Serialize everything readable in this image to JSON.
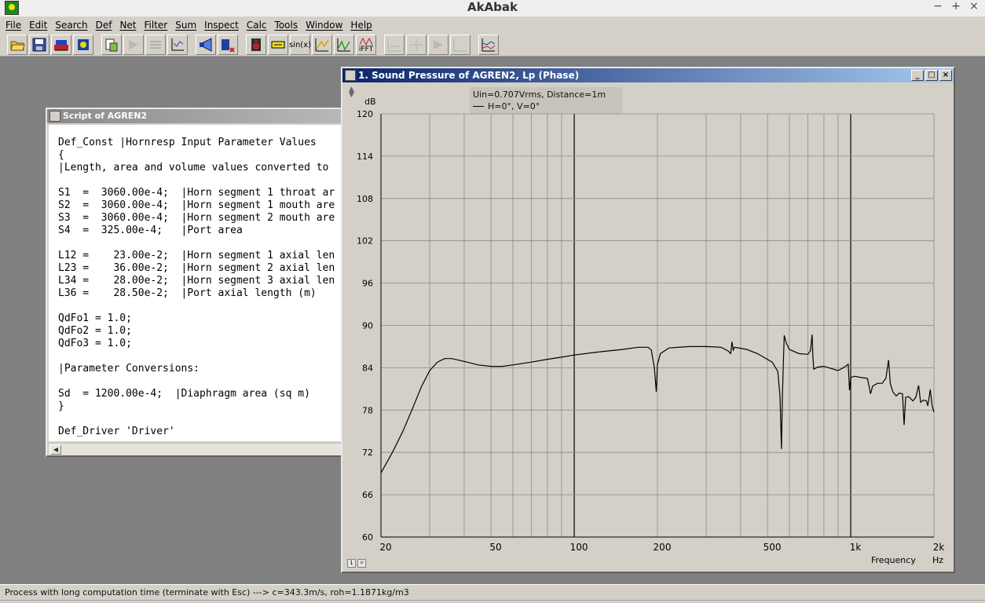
{
  "app": {
    "title": "AkAbak",
    "controls": {
      "minimize": "−",
      "maximize": "+",
      "close": "×"
    }
  },
  "menu": [
    {
      "label": "File",
      "icon": ""
    },
    {
      "label": "Edit"
    },
    {
      "label": "Search"
    },
    {
      "label": "Def"
    },
    {
      "label": "Net"
    },
    {
      "label": "Filter"
    },
    {
      "label": "Sum"
    },
    {
      "label": "Inspect"
    },
    {
      "label": "Calc"
    },
    {
      "label": "Tools"
    },
    {
      "label": "Window"
    },
    {
      "label": "Help"
    }
  ],
  "toolbar": {
    "sinx_label": "sin(x)",
    "ifft_label": "iFFT",
    "icons": [
      "open-folder-icon",
      "save-disk-icon",
      "run-net-icon",
      "driver-icon",
      "copy-script-icon",
      "disabled-icon",
      "disabled-icon",
      "axis-icon",
      "horn-icon",
      "port-icon",
      "speaker-icon",
      "filter-icon",
      "sinx-icon",
      "curve-icon",
      "green-curve-icon",
      "ifft-icon",
      "disabled-icon",
      "disabled-icon",
      "disabled-icon",
      "disabled-icon",
      "overlay-chart-icon"
    ]
  },
  "script_window": {
    "title": "Script of AGREN2",
    "lines": [
      "Def_Const |Hornresp Input Parameter Values",
      "{",
      "|Length, area and volume values converted to",
      "",
      "S1  =  3060.00e-4;  |Horn segment 1 throat ar",
      "S2  =  3060.00e-4;  |Horn segment 1 mouth are",
      "S3  =  3060.00e-4;  |Horn segment 2 mouth are",
      "S4  =  325.00e-4;   |Port area",
      "",
      "L12 =    23.00e-2;  |Horn segment 1 axial len",
      "L23 =    36.00e-2;  |Horn segment 2 axial len",
      "L34 =    28.00e-2;  |Horn segment 3 axial len",
      "L36 =    28.50e-2;  |Port axial length (m)",
      "",
      "QdFo1 = 1.0;",
      "QdFo2 = 1.0;",
      "QdFo3 = 1.0;",
      "",
      "|Parameter Conversions:",
      "",
      "Sd  = 1200.00e-4;  |Diaphragm area (sq m)",
      "}",
      "",
      "Def_Driver 'Driver'"
    ]
  },
  "plot_window": {
    "title": "1. Sound Pressure of AGREN2, Lp (Phase)",
    "legend": {
      "line1": "Uin=0.707Vrms, Distance=1m",
      "line2": "H=0°, V=0°"
    },
    "y_unit": "dB",
    "x_label": "Frequency",
    "x_unit": "Hz"
  },
  "chart_data": {
    "type": "line",
    "xscale": "log",
    "xlim": [
      20,
      2000
    ],
    "ylim": [
      60,
      120
    ],
    "yticks": [
      120,
      114,
      108,
      102,
      96,
      90,
      84,
      78,
      72,
      66,
      60
    ],
    "xticks": [
      {
        "value": 20,
        "label": "20"
      },
      {
        "value": 50,
        "label": "50"
      },
      {
        "value": 100,
        "label": "100"
      },
      {
        "value": 200,
        "label": "200"
      },
      {
        "value": 500,
        "label": "500"
      },
      {
        "value": 1000,
        "label": "1k"
      },
      {
        "value": 2000,
        "label": "2k"
      }
    ],
    "grid": true,
    "legend_position": "top-left",
    "series": [
      {
        "name": "H=0°, V=0°",
        "color": "#000000",
        "points": [
          [
            20,
            69.1
          ],
          [
            22,
            72.0
          ],
          [
            24,
            75.0
          ],
          [
            26,
            78.2
          ],
          [
            28,
            81.3
          ],
          [
            30,
            83.6
          ],
          [
            32,
            84.8
          ],
          [
            34,
            85.3
          ],
          [
            36,
            85.3
          ],
          [
            40,
            84.9
          ],
          [
            45,
            84.4
          ],
          [
            50,
            84.2
          ],
          [
            55,
            84.2
          ],
          [
            60,
            84.4
          ],
          [
            70,
            84.8
          ],
          [
            80,
            85.2
          ],
          [
            90,
            85.5
          ],
          [
            100,
            85.8
          ],
          [
            120,
            86.2
          ],
          [
            150,
            86.6
          ],
          [
            170,
            86.9
          ],
          [
            185,
            86.9
          ],
          [
            190,
            86.5
          ],
          [
            195,
            84.0
          ],
          [
            198,
            80.6
          ],
          [
            200,
            84.5
          ],
          [
            205,
            86.0
          ],
          [
            220,
            86.8
          ],
          [
            260,
            87.0
          ],
          [
            300,
            87.0
          ],
          [
            340,
            86.9
          ],
          [
            360,
            86.4
          ],
          [
            368,
            86.0
          ],
          [
            372,
            87.7
          ],
          [
            376,
            86.5
          ],
          [
            380,
            86.9
          ],
          [
            420,
            86.6
          ],
          [
            460,
            86.0
          ],
          [
            520,
            84.8
          ],
          [
            545,
            83.5
          ],
          [
            555,
            80.0
          ],
          [
            562,
            72.5
          ],
          [
            566,
            79.5
          ],
          [
            570,
            84.0
          ],
          [
            575,
            88.6
          ],
          [
            585,
            87.5
          ],
          [
            600,
            86.6
          ],
          [
            650,
            86.0
          ],
          [
            700,
            85.9
          ],
          [
            715,
            86.4
          ],
          [
            725,
            88.7
          ],
          [
            730,
            85.5
          ],
          [
            735,
            83.8
          ],
          [
            760,
            84.1
          ],
          [
            800,
            84.2
          ],
          [
            850,
            83.9
          ],
          [
            900,
            83.6
          ],
          [
            950,
            84.1
          ],
          [
            980,
            84.5
          ],
          [
            990,
            80.8
          ],
          [
            1000,
            82.6
          ],
          [
            1030,
            82.8
          ],
          [
            1100,
            82.6
          ],
          [
            1150,
            82.5
          ],
          [
            1180,
            80.3
          ],
          [
            1200,
            81.4
          ],
          [
            1250,
            81.8
          ],
          [
            1300,
            81.8
          ],
          [
            1340,
            82.5
          ],
          [
            1370,
            85.1
          ],
          [
            1390,
            81.8
          ],
          [
            1420,
            80.6
          ],
          [
            1460,
            80.0
          ],
          [
            1500,
            80.4
          ],
          [
            1540,
            80.3
          ],
          [
            1560,
            75.9
          ],
          [
            1580,
            79.8
          ],
          [
            1620,
            79.9
          ],
          [
            1680,
            79.3
          ],
          [
            1720,
            79.8
          ],
          [
            1760,
            81.5
          ],
          [
            1790,
            79.1
          ],
          [
            1830,
            79.4
          ],
          [
            1880,
            79.3
          ],
          [
            1900,
            78.6
          ],
          [
            1940,
            80.9
          ],
          [
            1970,
            78.6
          ],
          [
            2000,
            77.7
          ]
        ]
      }
    ]
  },
  "status": {
    "text": "Process with long computation time (terminate with Esc) ---> c=343.3m/s, roh=1.1871kg/m3"
  }
}
